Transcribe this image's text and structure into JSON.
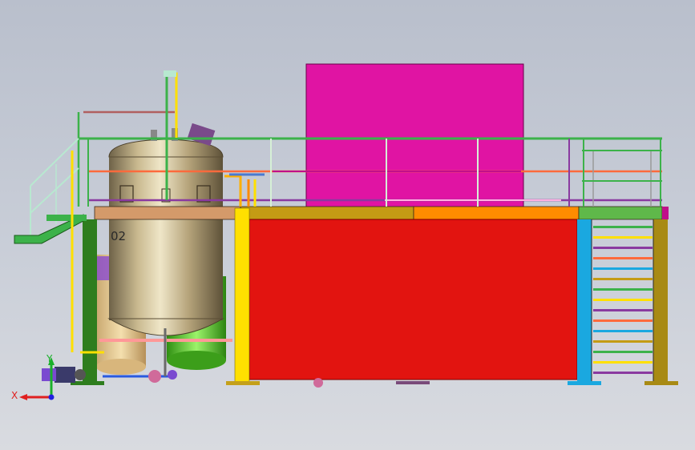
{
  "viewport": {
    "tank_tag": "02",
    "axis": {
      "x_label": "X",
      "y_label": "Y"
    }
  },
  "colors": {
    "background_top": "#b9bfcc",
    "background_bottom": "#d9dbe0",
    "control_cabinet": "#e014a3",
    "base_enclosure": "#e21410",
    "platform_deck_left": "#d49a6a",
    "platform_deck_mid": "#c49b14",
    "platform_deck_right": "#ff8c00",
    "platform_deck_end": "#5fb84a",
    "railing_top": "#3cb24a",
    "railing_mid": "#ff6a3c",
    "railing_low": "#8a3aa0",
    "column_yellow": "#ffe000",
    "column_cyan": "#1aa8e0",
    "column_olive": "#a88a14",
    "column_dark_green": "#2e7d1e",
    "tank_body": "#b8a67e",
    "tank_lower_green": "#5cd12e",
    "stair_stringer": "#1aa8e0"
  },
  "icons": [
    "axis-triad-icon",
    "pump-motor-icon",
    "valve-icon",
    "manhole-icon"
  ]
}
